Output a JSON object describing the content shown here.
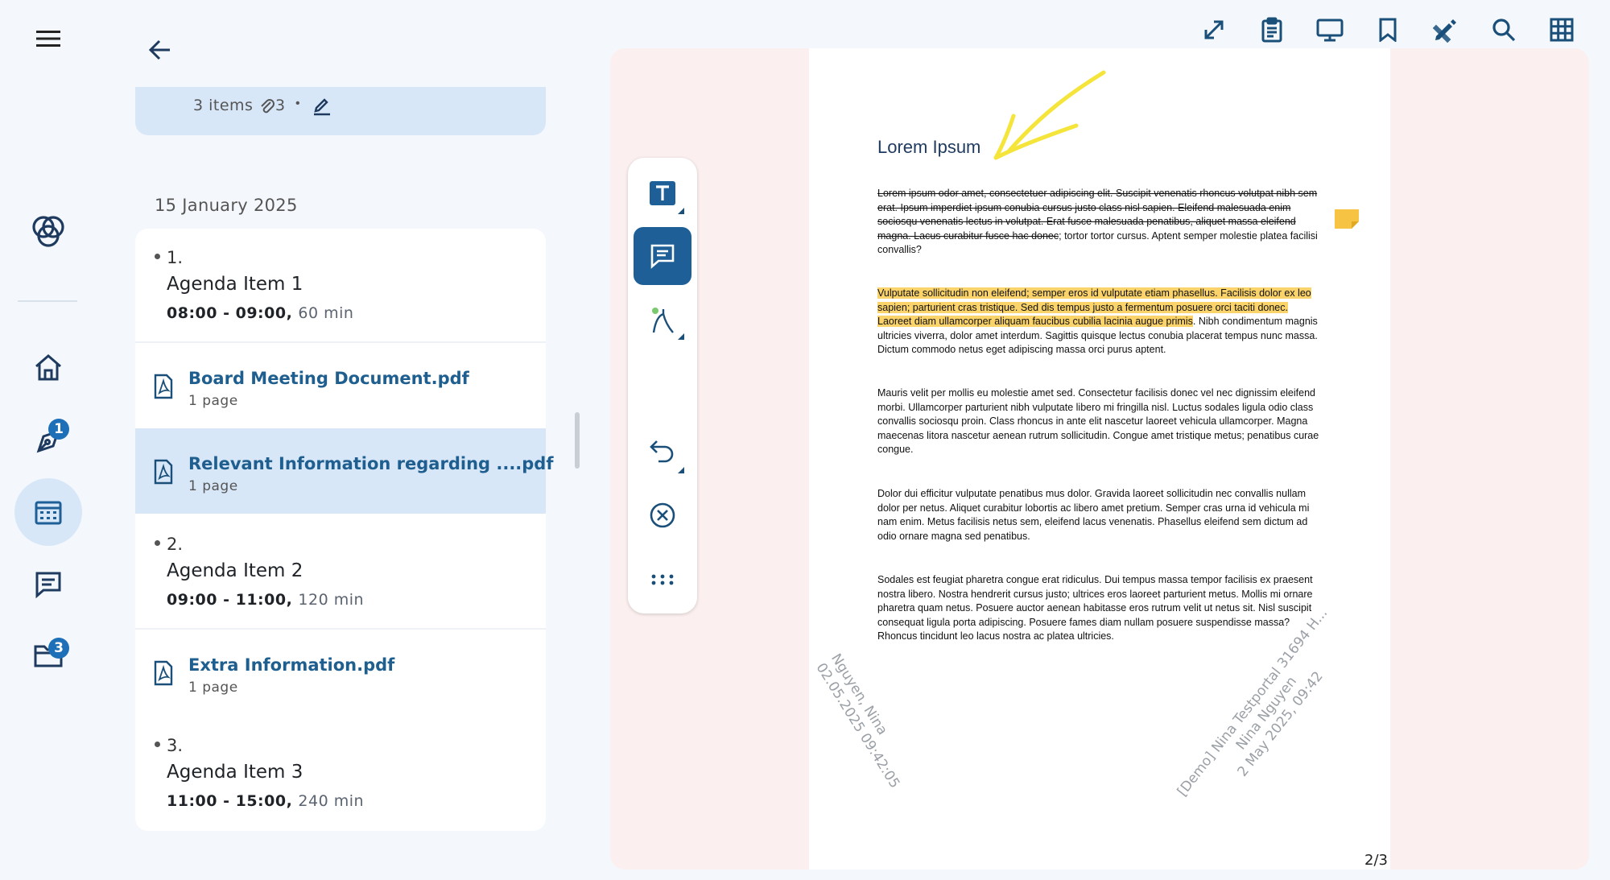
{
  "rail": {
    "badges": {
      "annotations": "1",
      "files": "3"
    }
  },
  "meeting_card": {
    "items_text": "3 items",
    "attachments_count": "3",
    "separator": "•"
  },
  "agenda": {
    "date": "15 January 2025",
    "items": [
      {
        "number": "1.",
        "title": "Agenda Item 1",
        "time": "08:00 - 09:00,",
        "duration": "60 min"
      },
      {
        "number": "2.",
        "title": "Agenda Item 2",
        "time": "09:00 - 11:00,",
        "duration": "120 min"
      },
      {
        "number": "3.",
        "title": "Agenda Item 3",
        "time": "11:00 - 15:00,",
        "duration": "240 min"
      }
    ],
    "documents": [
      {
        "title": "Board Meeting Document.pdf",
        "pages": "1 page"
      },
      {
        "title": "Relevant Information regarding ....pdf",
        "pages": "1 page"
      },
      {
        "title": "Extra Information.pdf",
        "pages": "1 page"
      }
    ]
  },
  "pdf": {
    "title": "Lorem Ipsum",
    "para1_strike": "Lorem ipsum odor amet, consectetuer adipiscing elit. Suscipit venenatis rhoncus volutpat nibh sem erat. Ipsum imperdiet ipsum conubia cursus justo class nisl sapien. Eleifend malesuada enim sociosqu venenatis lectus in volutpat. Erat fusce malesuada penatibus, aliquet massa eleifend magna. Lacus curabitur fusce hac donec",
    "para1_rest": "; tortor tortor cursus. Aptent semper molestie platea facilisi convallis?",
    "para2_highlight": "Vulputate sollicitudin non eleifend; semper eros id vulputate etiam phasellus. Facilisis dolor ex leo sapien; parturient cras tristique. Sed dis tempus justo a fermentum posuere orci taciti donec. Laoreet diam ullamcorper aliquam faucibus cubilia lacinia augue primis",
    "para2_rest": ". Nibh condimentum magnis ultricies viverra, dolor amet interdum. Sagittis quisque lectus conubia placerat tempus nunc massa. Dictum commodo netus eget adipiscing massa orci purus aptent.",
    "para3": "Mauris velit per mollis eu molestie amet sed. Consectetur facilisis donec vel nec dignissim eleifend morbi. Ullamcorper parturient nibh vulputate libero mi fringilla nisl. Luctus sodales ligula odio class convallis sociosqu proin. Class rhoncus in ante elit nascetur laoreet vehicula ullamcorper. Magna maecenas litora nascetur aenean rutrum sollicitudin. Congue amet tristique metus; penatibus curae congue.",
    "para4": "Dolor dui efficitur vulputate penatibus mus dolor. Gravida laoreet sollicitudin nec convallis nullam dolor per netus. Aliquet curabitur lobortis ac libero amet pretium. Semper cras urna id vehicula mi nam enim. Metus facilisis netus sem, eleifend lacus venenatis. Phasellus eleifend sem dictum ad odio ornare magna sed penatibus.",
    "para5": "Sodales est feugiat pharetra congue erat ridiculus. Dui tempus massa tempor facilisis ex praesent nostra libero. Nostra hendrerit cursus justo; ultrices eros laoreet parturient metus. Mollis mi ornare pharetra quam netus. Posuere auctor aenean habitasse eros rutrum velit ut netus sit. Nisl suscipit consequat ligula porta adipiscing. Posuere fames diam nullam posuere suspendisse massa? Rhoncus tincidunt leo lacus nostra ac platea ultricies.",
    "stamp1": {
      "line1": "Nguyen, Nina",
      "line2": "02.05.2025 09:42:05"
    },
    "stamp2": {
      "line1": "[Demo] Nina Testportal 31694 H...",
      "line2": "Nina Nguyen",
      "line3": "2 May 2025, 09:42"
    },
    "page_indicator": "2/3"
  },
  "colors": {
    "accent": "#1d5f96",
    "highlight": "#fbd36b",
    "ink_yellow": "#f5e43a",
    "sticky_note": "#f6c343"
  }
}
